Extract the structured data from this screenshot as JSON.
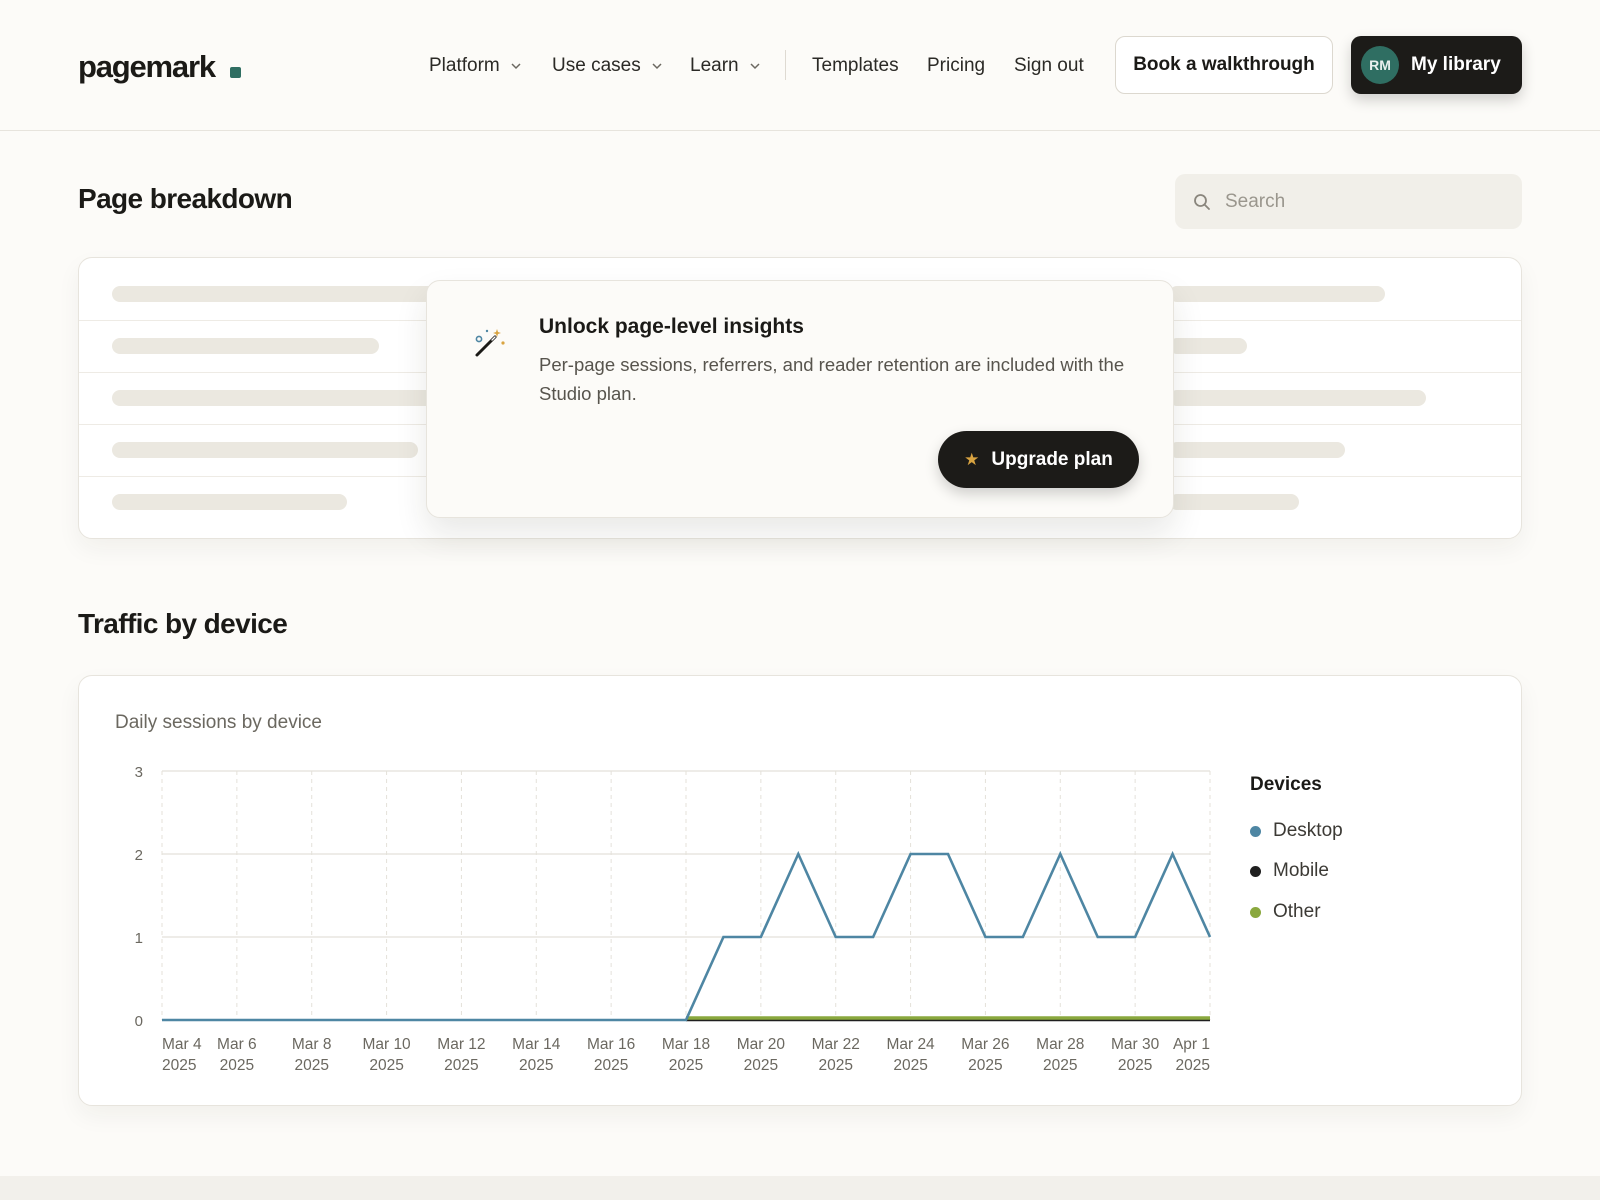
{
  "brand": {
    "name": "pagemark"
  },
  "nav": {
    "items": [
      {
        "label": "Platform",
        "dropdown": true
      },
      {
        "label": "Use cases",
        "dropdown": true
      },
      {
        "label": "Learn",
        "dropdown": true
      },
      {
        "label": "Templates",
        "dropdown": false
      },
      {
        "label": "Pricing",
        "dropdown": false
      },
      {
        "label": "Sign out",
        "dropdown": false
      }
    ],
    "cta_secondary": "Book a walkthrough",
    "cta_primary": "My library",
    "avatar_initials": "RM"
  },
  "page_breakdown": {
    "title": "Page breakdown",
    "search_placeholder": "Search",
    "upsell": {
      "icon": "magic-wand-icon",
      "title": "Unlock page-level insights",
      "body": "Per-page sessions, referrers, and reader retention are included with the Studio plan.",
      "button": "Upgrade plan",
      "button_icon": "star-icon"
    }
  },
  "traffic": {
    "title": "Traffic by device",
    "chart_subtitle": "Daily sessions by device",
    "legend_title": "Devices"
  },
  "chart_data": {
    "type": "line",
    "title": "Daily sessions by device",
    "x": [
      "Mar 4 2025",
      "Mar 5 2025",
      "Mar 6 2025",
      "Mar 7 2025",
      "Mar 8 2025",
      "Mar 9 2025",
      "Mar 10 2025",
      "Mar 11 2025",
      "Mar 12 2025",
      "Mar 13 2025",
      "Mar 14 2025",
      "Mar 15 2025",
      "Mar 16 2025",
      "Mar 17 2025",
      "Mar 18 2025",
      "Mar 19 2025",
      "Mar 20 2025",
      "Mar 21 2025",
      "Mar 22 2025",
      "Mar 23 2025",
      "Mar 24 2025",
      "Mar 25 2025",
      "Mar 26 2025",
      "Mar 27 2025",
      "Mar 28 2025",
      "Mar 29 2025",
      "Mar 30 2025",
      "Mar 31 2025",
      "Apr 1 2025"
    ],
    "x_tick_labels": [
      [
        "Mar 4",
        "2025"
      ],
      [
        "Mar 6",
        "2025"
      ],
      [
        "Mar 8",
        "2025"
      ],
      [
        "Mar 10",
        "2025"
      ],
      [
        "Mar 12",
        "2025"
      ],
      [
        "Mar 14",
        "2025"
      ],
      [
        "Mar 16",
        "2025"
      ],
      [
        "Mar 18",
        "2025"
      ],
      [
        "Mar 20",
        "2025"
      ],
      [
        "Mar 22",
        "2025"
      ],
      [
        "Mar 24",
        "2025"
      ],
      [
        "Mar 26",
        "2025"
      ],
      [
        "Mar 28",
        "2025"
      ],
      [
        "Mar 30",
        "2025"
      ],
      [
        "Apr 1",
        "2025"
      ]
    ],
    "y_ticks": [
      0,
      1,
      2,
      3
    ],
    "ylim": [
      0,
      3
    ],
    "grid": true,
    "legend_title": "Devices",
    "legend_position": "right",
    "series": [
      {
        "name": "Desktop",
        "color": "#4e86a3",
        "values": [
          0,
          0,
          0,
          0,
          0,
          0,
          0,
          0,
          0,
          0,
          0,
          0,
          0,
          0,
          0,
          1,
          1,
          2,
          1,
          1,
          2,
          2,
          1,
          1,
          2,
          1,
          1,
          2,
          1
        ]
      },
      {
        "name": "Mobile",
        "color": "#1f1f1f",
        "values": [
          0,
          0,
          0,
          0,
          0,
          0,
          0,
          0,
          0,
          0,
          0,
          0,
          0,
          0,
          0,
          0,
          0,
          0,
          0,
          0,
          0,
          0,
          0,
          0,
          0,
          0,
          0,
          0,
          0
        ]
      },
      {
        "name": "Other",
        "color": "#8aa83e",
        "values": [
          0,
          0,
          0,
          0,
          0,
          0,
          0,
          0,
          0,
          0,
          0,
          0,
          0,
          0,
          0,
          0,
          0,
          0,
          0,
          0,
          0,
          0,
          0,
          0,
          0,
          0,
          0,
          0,
          0
        ]
      }
    ]
  }
}
